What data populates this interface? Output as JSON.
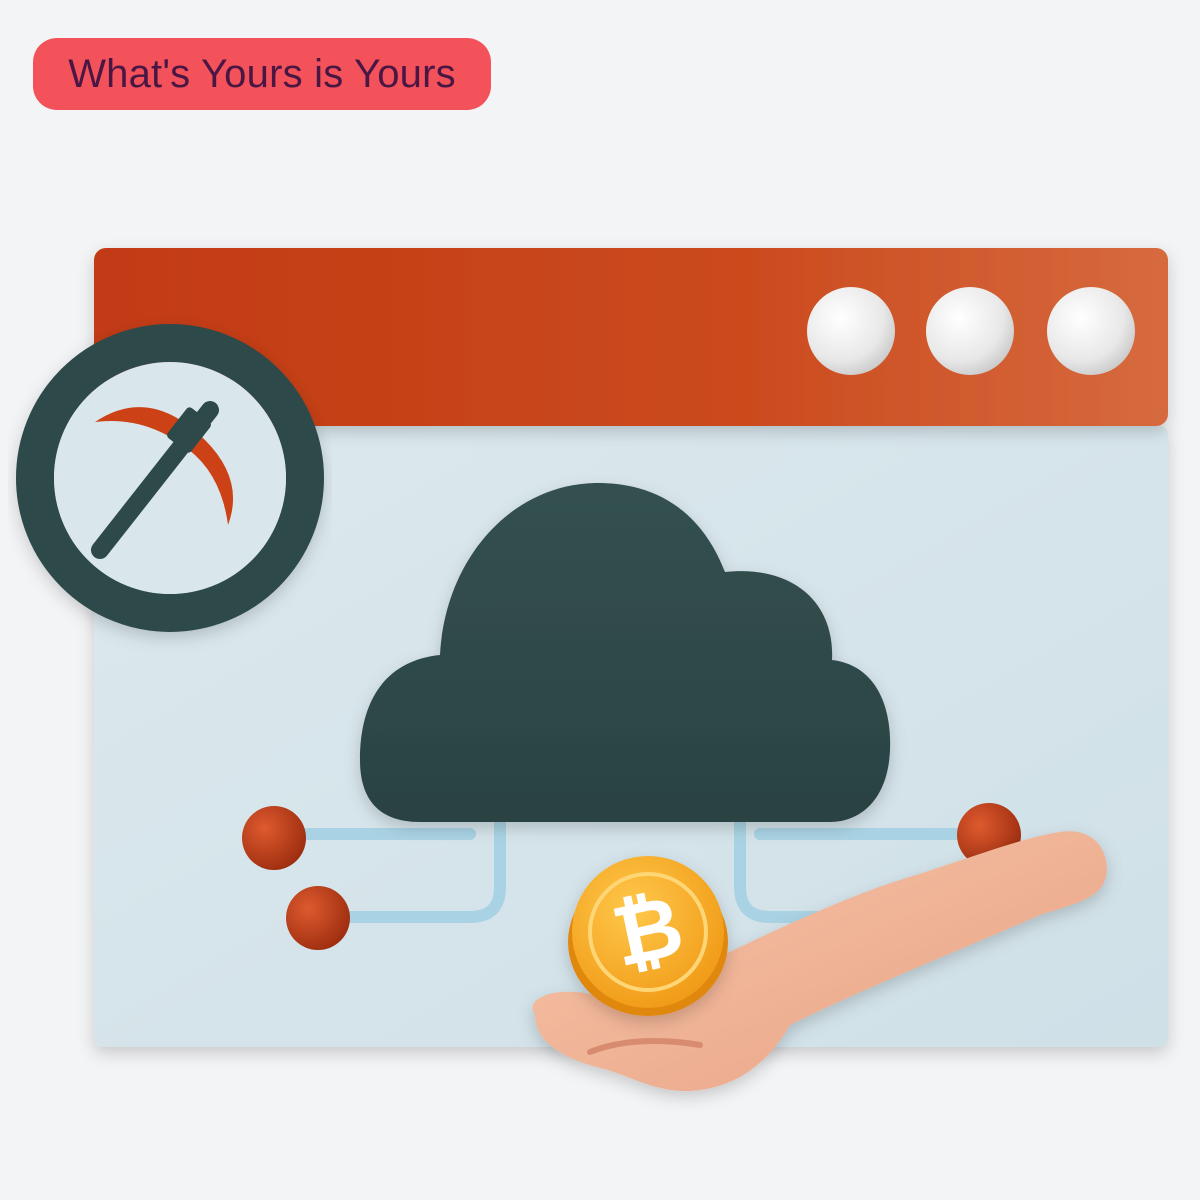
{
  "banner": {
    "label": "What's Yours is Yours"
  },
  "window": {
    "title_bar_color": "#c9421c",
    "body_color": "#d7e6ec",
    "controls": [
      "window-control-1",
      "window-control-2",
      "window-control-3"
    ]
  },
  "icons": {
    "badge": "pickaxe-icon",
    "center": "cloud-icon",
    "coin": "bitcoin-icon",
    "hand": "hand-icon"
  },
  "coin": {
    "symbol": "₿"
  },
  "colors": {
    "accent": "#f4525a",
    "banner_text": "#4a1744",
    "dark": "#2f4848",
    "orange": "#c9421c",
    "coin": "#f5a623"
  }
}
